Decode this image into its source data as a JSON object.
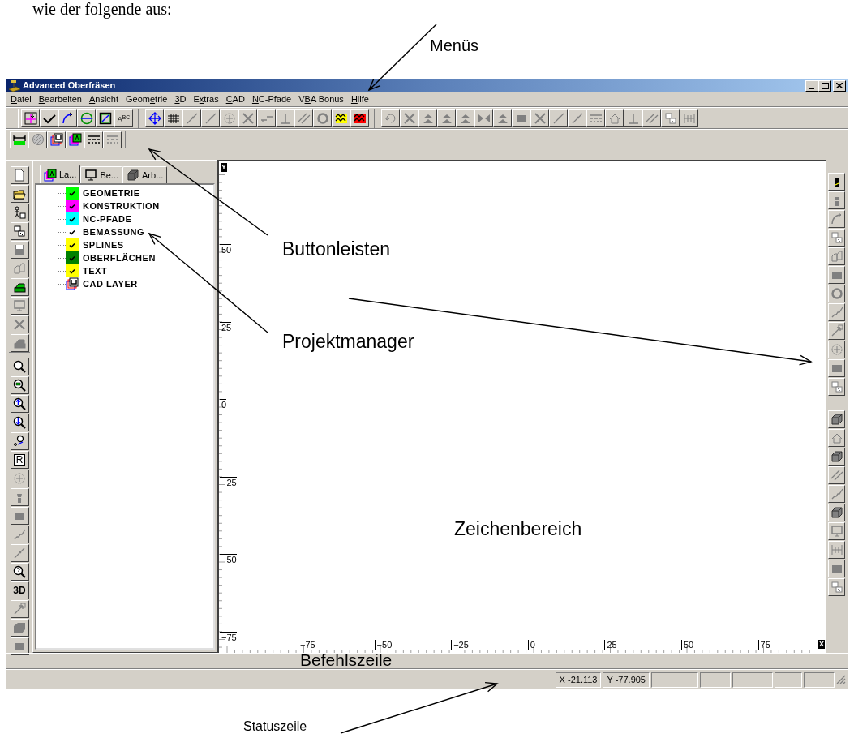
{
  "intro_text": "wie der folgende aus:",
  "annotations": [
    {
      "text": "Menüs"
    },
    {
      "text": "Buttonleisten"
    },
    {
      "text": "Projektmanager"
    },
    {
      "text": "Zeichenbereich"
    },
    {
      "text": "Befehlszeile"
    },
    {
      "text": "Statuszeile"
    }
  ],
  "window": {
    "title": "Advanced Oberfräsen"
  },
  "menu": [
    {
      "label": "Datei"
    },
    {
      "label": "Bearbeiten"
    },
    {
      "label": "Ansicht"
    },
    {
      "label": "Geometrie"
    },
    {
      "label": "3D"
    },
    {
      "label": "Extras"
    },
    {
      "label": "CAD"
    },
    {
      "label": "NC-Pfade"
    },
    {
      "label": "VBA Bonus"
    },
    {
      "label": "Hilfe"
    }
  ],
  "toolbars": [
    {
      "buttons": [
        {
          "disabled": false
        },
        {
          "disabled": false
        },
        {
          "disabled": false
        },
        {
          "disabled": false
        },
        {
          "disabled": false
        },
        {
          "disabled": false,
          "label": "A$^{B}$$^{C}$"
        }
      ]
    },
    {
      "buttons": [
        {
          "disabled": false
        },
        {
          "disabled": false
        },
        {
          "disabled": true
        },
        {
          "disabled": true
        },
        {
          "disabled": true
        },
        {
          "disabled": true
        },
        {
          "disabled": true
        },
        {
          "disabled": true
        },
        {
          "disabled": true
        },
        {
          "disabled": true
        },
        {
          "disabled": false
        },
        {
          "disabled": false
        }
      ]
    },
    {
      "buttons": [
        {
          "disabled": true
        },
        {
          "disabled": true
        },
        {
          "disabled": true
        },
        {
          "disabled": true
        },
        {
          "disabled": true
        },
        {
          "disabled": true
        },
        {
          "disabled": true
        },
        {
          "disabled": true
        },
        {
          "disabled": true
        },
        {
          "disabled": true
        },
        {
          "disabled": true
        },
        {
          "disabled": true
        },
        {
          "disabled": true
        },
        {
          "disabled": true
        },
        {
          "disabled": true
        },
        {
          "disabled": true
        },
        {
          "disabled": true
        }
      ]
    },
    {
      "buttons": [
        {
          "disabled": false
        },
        {
          "disabled": true
        },
        {
          "disabled": false
        },
        {
          "disabled": false
        },
        {
          "disabled": false
        },
        {
          "disabled": true
        }
      ]
    },
    {
      "buttons": [
        {
          "disabled": false
        },
        {
          "disabled": false
        },
        {
          "disabled": false
        },
        {
          "disabled": false
        },
        {
          "disabled": true
        },
        {
          "disabled": true
        },
        {
          "disabled": false
        },
        {
          "disabled": true
        },
        {
          "disabled": true
        },
        {
          "disabled": true
        }
      ]
    },
    {
      "buttons": [
        {
          "disabled": false
        },
        {
          "disabled": false
        },
        {
          "disabled": false
        },
        {
          "disabled": false
        },
        {
          "disabled": false
        },
        {
          "disabled": false,
          "label": "R"
        },
        {
          "disabled": true
        },
        {
          "disabled": true
        },
        {
          "disabled": true
        },
        {
          "disabled": true
        },
        {
          "disabled": true
        },
        {
          "disabled": false
        },
        {
          "disabled": false,
          "label": "3D"
        },
        {
          "disabled": true
        },
        {
          "disabled": true
        },
        {
          "disabled": true
        }
      ]
    },
    {
      "buttons": [
        {
          "disabled": false
        },
        {
          "disabled": true
        },
        {
          "disabled": true
        },
        {
          "disabled": true
        },
        {
          "disabled": true
        },
        {
          "disabled": true
        },
        {
          "disabled": true
        },
        {
          "disabled": true
        },
        {
          "disabled": true
        },
        {
          "disabled": true
        },
        {
          "disabled": true
        },
        {
          "disabled": true
        }
      ]
    },
    {
      "buttons": [
        {
          "disabled": true
        },
        {
          "disabled": true
        },
        {
          "disabled": true
        },
        {
          "disabled": true
        },
        {
          "disabled": true
        },
        {
          "disabled": true
        },
        {
          "disabled": true
        },
        {
          "disabled": true
        },
        {
          "disabled": true
        },
        {
          "disabled": true
        }
      ]
    }
  ],
  "project_manager": {
    "tabs": [
      {
        "label": "La...",
        "selected": true
      },
      {
        "label": "Be...",
        "selected": false
      },
      {
        "label": "Arb...",
        "selected": false
      }
    ],
    "tree": [
      {
        "kind": "layer",
        "label": "GEOMETRIE",
        "color": "#00ff00",
        "checked": true
      },
      {
        "kind": "layer",
        "label": "KONSTRUKTION",
        "color": "#ff00ff",
        "checked": true
      },
      {
        "kind": "layer",
        "label": "NC-PFADE",
        "color": "#00ffff",
        "checked": true
      },
      {
        "kind": "layer",
        "label": "BEMASSUNG",
        "color": "#ffffff",
        "checked": true
      },
      {
        "kind": "layer",
        "label": "SPLINES",
        "color": "#ffff00",
        "checked": true
      },
      {
        "kind": "layer",
        "label": "OBERFLÄCHEN",
        "color": "#008000",
        "checked": true
      },
      {
        "kind": "layer",
        "label": "TEXT",
        "color": "#ffff00",
        "checked": true
      },
      {
        "kind": "cad",
        "label": "CAD LAYER"
      }
    ]
  },
  "drawing_area": {
    "y_marker": "Y",
    "x_marker": "X",
    "y_labels": [
      "50",
      "25",
      "0",
      "−25",
      "−50",
      "−75"
    ],
    "x_labels": [
      "−75",
      "−50",
      "−25",
      "0",
      "25",
      "50",
      "75"
    ]
  },
  "status_bar": {
    "coordinates": [
      "X -21.113",
      "Y -77.905"
    ]
  }
}
